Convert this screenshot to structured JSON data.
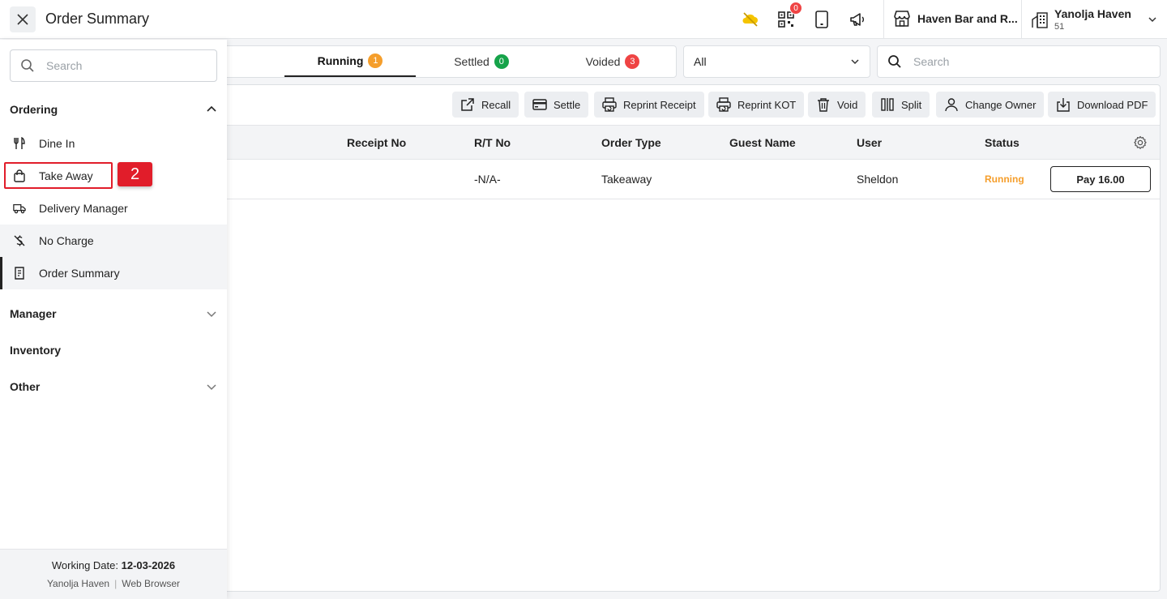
{
  "header": {
    "title": "Order Summary",
    "qr_badge": "0",
    "outlet": "Haven Bar and R...",
    "account_name": "Yanolja Haven",
    "account_sub": "51"
  },
  "tabs": [
    {
      "label": "Running",
      "count": "1",
      "color": "#f59e2b"
    },
    {
      "label": "Settled",
      "count": "0",
      "color": "#16a34a"
    },
    {
      "label": "Voided",
      "count": "3",
      "color": "#ef4444"
    }
  ],
  "filter": {
    "selected": "All"
  },
  "search": {
    "placeholder": "Search"
  },
  "toolbar": {
    "recall": "Recall",
    "settle": "Settle",
    "reprint_receipt": "Reprint Receipt",
    "reprint_kot": "Reprint KOT",
    "void": "Void",
    "split": "Split",
    "change_owner": "Change Owner",
    "download_pdf": "Download PDF"
  },
  "table": {
    "columns": [
      "Receipt No",
      "R/T No",
      "Order Type",
      "Guest Name",
      "User",
      "Status"
    ],
    "rows": [
      {
        "receipt_no": "",
        "rt_no": "-N/A-",
        "order_type": "Takeaway",
        "guest_name": "",
        "user": "Sheldon",
        "status": "Running",
        "action": "Pay 16.00"
      }
    ]
  },
  "sidebar": {
    "search_placeholder": "Search",
    "sections": {
      "ordering": "Ordering",
      "manager": "Manager",
      "inventory": "Inventory",
      "other": "Other"
    },
    "items": [
      {
        "label": "Dine In",
        "icon": "fork-knife-icon"
      },
      {
        "label": "Take Away",
        "icon": "shopping-bag-icon"
      },
      {
        "label": "Delivery Manager",
        "icon": "truck-icon"
      },
      {
        "label": "No Charge",
        "icon": "no-dollar-icon"
      },
      {
        "label": "Order Summary",
        "icon": "receipt-icon"
      }
    ],
    "step_badge": "2",
    "footer": {
      "working_date_label": "Working Date:",
      "working_date": "12-03-2026",
      "org": "Yanolja Haven",
      "platform": "Web Browser"
    }
  },
  "colors": {
    "accent": "#f59e2b",
    "highlight": "#e11d2a",
    "cloud": "#f5c400"
  }
}
